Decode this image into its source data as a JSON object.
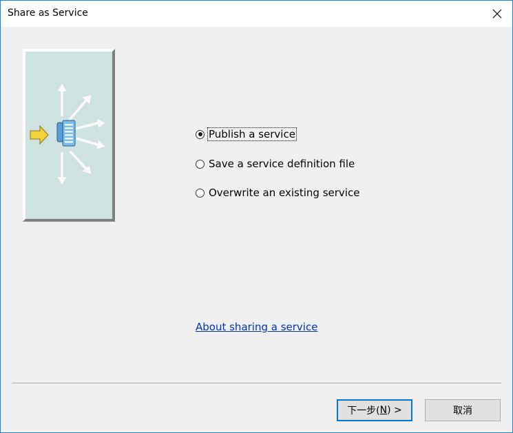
{
  "window": {
    "title": "Share as Service",
    "border_color": "#1883d7"
  },
  "illustration": {
    "icon": "share-service-illustration",
    "background": "#cfe2e2"
  },
  "options": [
    {
      "label": "Publish a service",
      "checked": true
    },
    {
      "label": "Save a service definition file",
      "checked": false
    },
    {
      "label": "Overwrite an existing service",
      "checked": false
    }
  ],
  "link": {
    "label": "About sharing a service"
  },
  "buttons": {
    "next_label": "下一步(N) >",
    "cancel_label": "取消"
  },
  "colors": {
    "accent": "#0078d7",
    "link": "#0033bb"
  }
}
